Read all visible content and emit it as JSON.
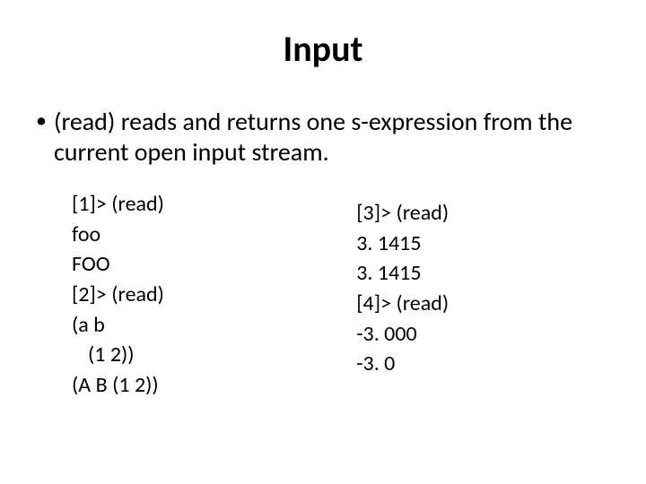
{
  "title": "Input",
  "bullet": {
    "marker": "•",
    "text": "(read) reads and returns one s-expression from the current open input stream."
  },
  "left": {
    "l1": "[1]> (read)",
    "l2": "foo",
    "l3": "FOO",
    "l4": "[2]> (read)",
    "l5": "(a b",
    "l6": "(1 2))",
    "l7": "(A B (1 2))"
  },
  "right": {
    "l1": "[3]> (read)",
    "l2": "3. 1415",
    "l3": "3. 1415",
    "l4": "[4]> (read)",
    "l5": "-3. 000",
    "l6": "-3. 0"
  }
}
